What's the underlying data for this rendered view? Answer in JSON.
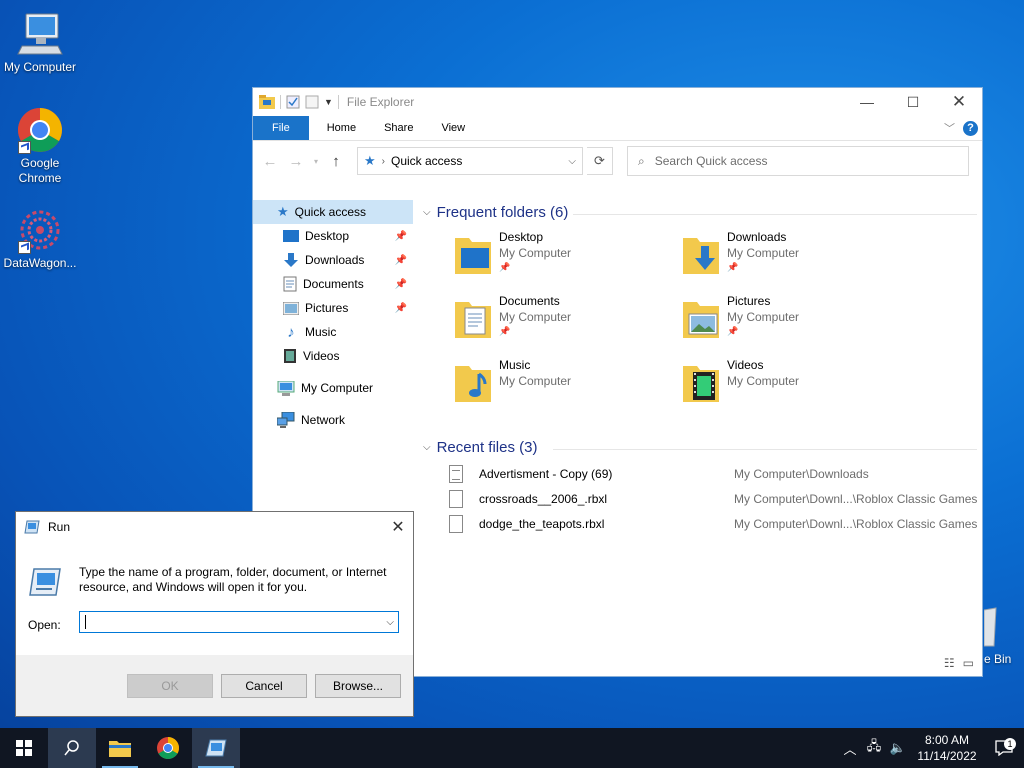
{
  "desktop": {
    "icons": [
      {
        "label": "My Computer"
      },
      {
        "label": "Google Chrome"
      },
      {
        "label": "DataWagon..."
      }
    ],
    "recycle_bin_label": "e Bin"
  },
  "explorer": {
    "title": "File Explorer",
    "ribbon_tabs": [
      "File",
      "Home",
      "Share",
      "View"
    ],
    "help": "?",
    "address": "Quick access",
    "search_placeholder": "Search Quick access",
    "nav": {
      "quick_access": "Quick access",
      "items": [
        "Desktop",
        "Downloads",
        "Documents",
        "Pictures",
        "Music",
        "Videos"
      ],
      "my_computer": "My Computer",
      "network": "Network"
    },
    "frequent_header": "Frequent folders (6)",
    "folders": [
      {
        "name": "Desktop",
        "location": "My Computer"
      },
      {
        "name": "Downloads",
        "location": "My Computer"
      },
      {
        "name": "Documents",
        "location": "My Computer"
      },
      {
        "name": "Pictures",
        "location": "My Computer"
      },
      {
        "name": "Music",
        "location": "My Computer"
      },
      {
        "name": "Videos",
        "location": "My Computer"
      }
    ],
    "recent_header": "Recent files (3)",
    "recent": [
      {
        "name": "Advertisment - Copy (69)",
        "path": "My Computer\\Downloads"
      },
      {
        "name": "crossroads__2006_.rbxl",
        "path": "My Computer\\Downl...\\Roblox Classic Games"
      },
      {
        "name": "dodge_the_teapots.rbxl",
        "path": "My Computer\\Downl...\\Roblox Classic Games"
      }
    ]
  },
  "run": {
    "title": "Run",
    "description": "Type the name of a program, folder, document, or Internet resource, and Windows will open it for you.",
    "open_label": "Open:",
    "value": "",
    "ok": "OK",
    "cancel": "Cancel",
    "browse": "Browse..."
  },
  "taskbar": {
    "time": "8:00 AM",
    "date": "11/14/2022",
    "notification_count": "1"
  },
  "colors": {
    "accent": "#1a73c9",
    "folder": "#f2c94c",
    "selection": "#cce4f7"
  }
}
